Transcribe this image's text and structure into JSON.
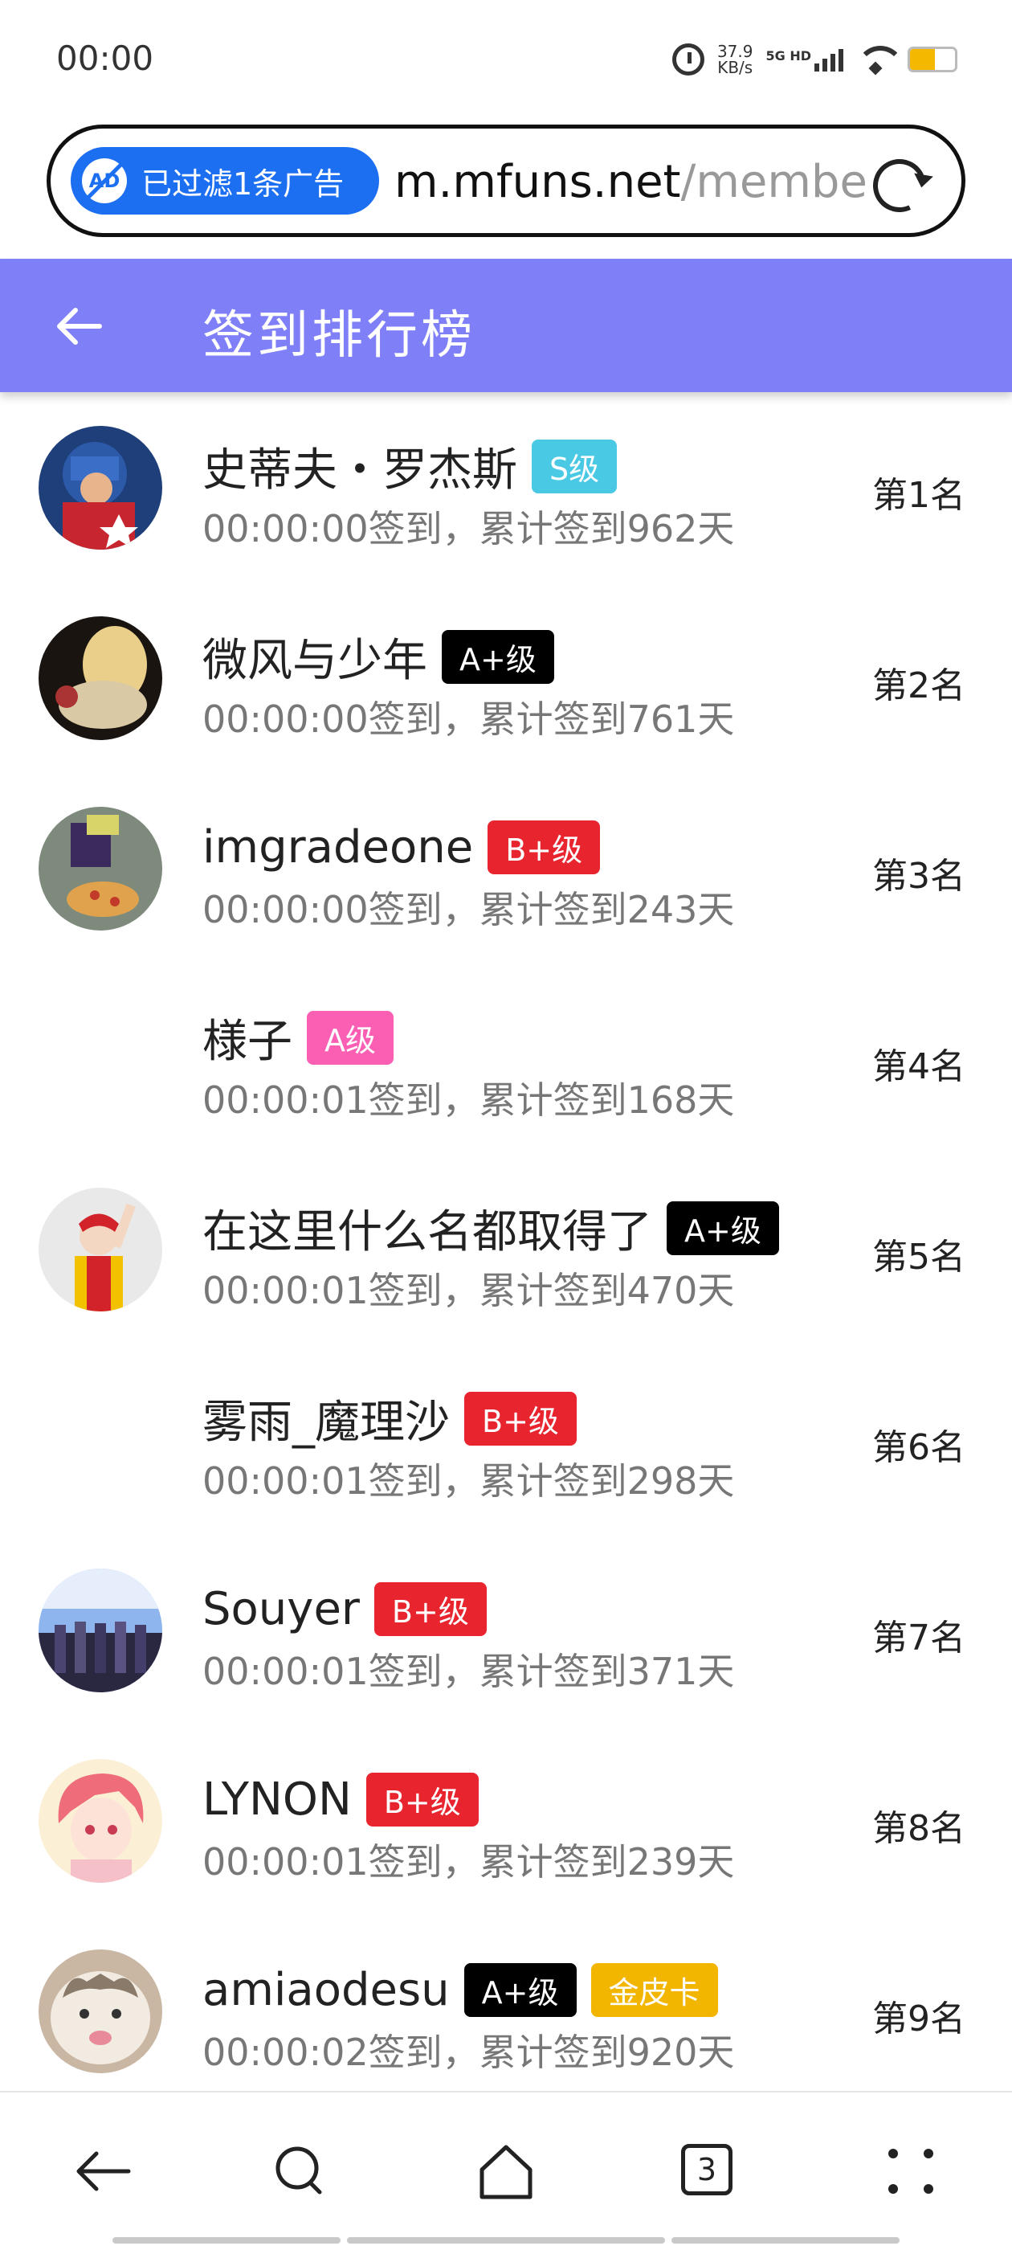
{
  "status_bar": {
    "time": "00:00",
    "net_speed_value": "37.9",
    "net_speed_unit": "KB/s",
    "network": "5G HD",
    "battery_level": 0.55,
    "battery_color": "#f5b800",
    "icons": [
      "alarm-icon",
      "signal-icon",
      "wifi-icon",
      "battery-icon"
    ]
  },
  "url_bar": {
    "ad_filter_text": "已过滤1条广告",
    "ad_icon_text": "AD",
    "url_host": "m.mfuns.net",
    "url_path": "/membe",
    "accent_color": "#1d6ff2"
  },
  "header": {
    "title": "签到排行榜",
    "background": "#7f7ff8"
  },
  "ranking": [
    {
      "name": "史蒂夫・罗杰斯",
      "badges": [
        {
          "label": "S级",
          "color": "#49c9e3"
        }
      ],
      "checkin": "00:00:00签到，累计签到962天",
      "rank": "第1名"
    },
    {
      "name": "微风与少年",
      "badges": [
        {
          "label": "A+级",
          "color": "#000000"
        }
      ],
      "checkin": "00:00:00签到，累计签到761天",
      "rank": "第2名"
    },
    {
      "name": "imgradeone",
      "badges": [
        {
          "label": "B+级",
          "color": "#e8242f"
        }
      ],
      "checkin": "00:00:00签到，累计签到243天",
      "rank": "第3名"
    },
    {
      "name": "様子",
      "badges": [
        {
          "label": "A级",
          "color": "#fb5fb3"
        }
      ],
      "checkin": "00:00:01签到，累计签到168天",
      "rank": "第4名"
    },
    {
      "name": "在这里什么名都取得了",
      "badges": [
        {
          "label": "A+级",
          "color": "#000000"
        }
      ],
      "checkin": "00:00:01签到，累计签到470天",
      "rank": "第5名"
    },
    {
      "name": "雾雨_魔理沙",
      "badges": [
        {
          "label": "B+级",
          "color": "#e8242f"
        }
      ],
      "checkin": "00:00:01签到，累计签到298天",
      "rank": "第6名"
    },
    {
      "name": "Souyer",
      "badges": [
        {
          "label": "B+级",
          "color": "#e8242f"
        }
      ],
      "checkin": "00:00:01签到，累计签到371天",
      "rank": "第7名"
    },
    {
      "name": "LYNON",
      "badges": [
        {
          "label": "B+级",
          "color": "#e8242f"
        }
      ],
      "checkin": "00:00:01签到，累计签到239天",
      "rank": "第8名"
    },
    {
      "name": "amiaodesu",
      "badges": [
        {
          "label": "A+级",
          "color": "#000000"
        },
        {
          "label": "金皮卡",
          "color": "#f3b600"
        }
      ],
      "checkin": "00:00:02签到，累计签到920天",
      "rank": "第9名"
    }
  ],
  "bottom_nav": {
    "tab_count": "3",
    "icons": [
      "back-icon",
      "search-icon",
      "home-icon",
      "tabs-icon",
      "menu-icon"
    ]
  }
}
